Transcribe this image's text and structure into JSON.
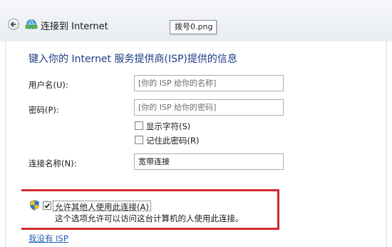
{
  "window": {
    "title": "连接到 Internet",
    "tooltip": "拨号0.png"
  },
  "form": {
    "heading": "键入你的 Internet 服务提供商(ISP)提供的信息",
    "username": {
      "label": "用户名(U):",
      "placeholder": "[你的 ISP 给你的名称]"
    },
    "password": {
      "label": "密码(P):",
      "placeholder": "[你的 ISP 给你的密码]"
    },
    "show_chars": {
      "label": "显示字符(S)",
      "checked": false
    },
    "remember_password": {
      "label": "记住此密码(R)",
      "checked": false
    },
    "connection_name": {
      "label": "连接名称(N):",
      "value": "宽带连接"
    },
    "allow_others": {
      "label": "允许其他人使用此连接(A)",
      "checked": true,
      "description": "这个选项允许可以访问这台计算机的人使用此连接。"
    },
    "no_isp_link": "我没有 ISP"
  },
  "colors": {
    "heading": "#1c3d86",
    "link": "#1f5fb5",
    "highlight_box": "#d12a2f"
  },
  "icons": {
    "back": "back-arrow-icon",
    "network": "network-connection-icon",
    "shield": "uac-shield-icon",
    "check": "checkmark-icon"
  }
}
